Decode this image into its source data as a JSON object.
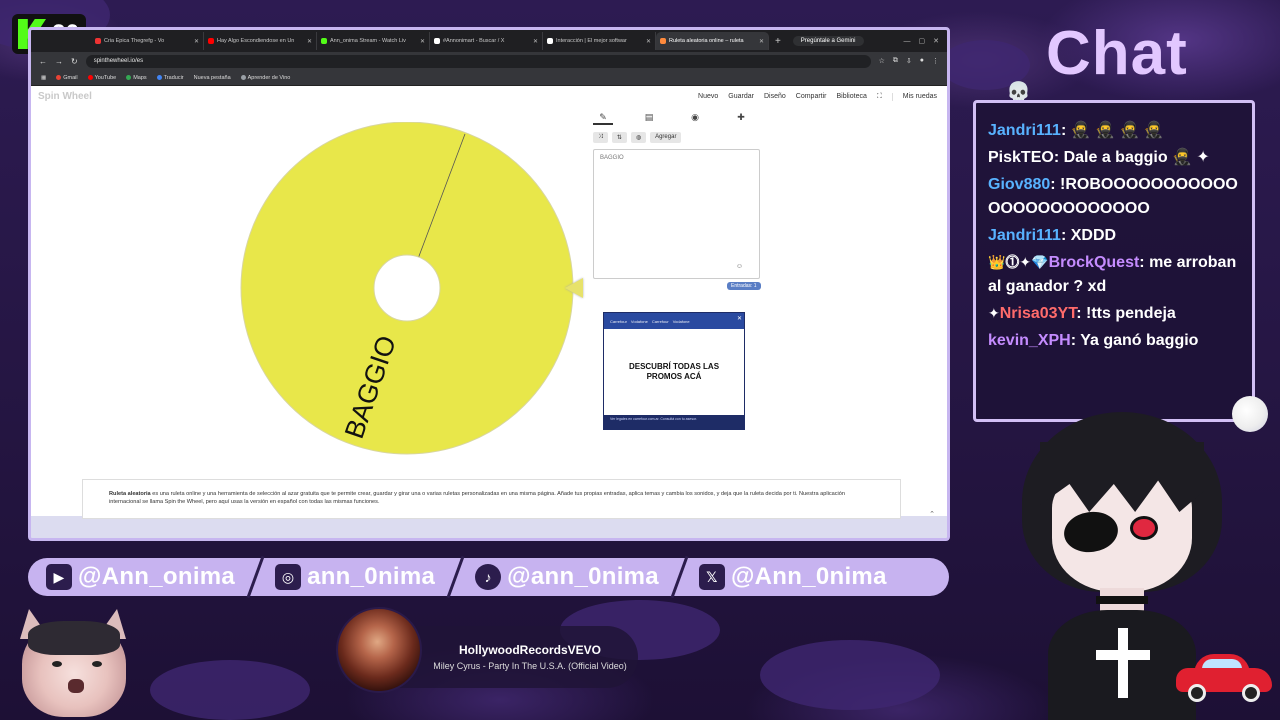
{
  "stream": {
    "viewer_count": "26"
  },
  "browser": {
    "tabs": [
      {
        "label": "Cria Épica Thegrefg - Vo",
        "color": "#e33"
      },
      {
        "label": "Hay Algo Escondiendose en Un",
        "color": "#f00"
      },
      {
        "label": "Ann_onima Stream - Watch Liv",
        "color": "#53fc18"
      },
      {
        "label": "#Annonimart - Buscar / X",
        "color": "#ffffff"
      },
      {
        "label": "Interacción | El mejor softwar",
        "color": "#ffffff"
      },
      {
        "label": "Ruleta aleatoria online – ruleta",
        "color": "#ff8a3d"
      }
    ],
    "gemini_label": "Pregúntale a Gemini",
    "url": "spinthewheel.io/es",
    "bookmarks": [
      {
        "label": "Gmail",
        "color": "#ea4335"
      },
      {
        "label": "YouTube",
        "color": "#ff0000"
      },
      {
        "label": "Maps",
        "color": "#34a853"
      },
      {
        "label": "Traducir",
        "color": "#4285f4"
      },
      {
        "label": "Nueva pestaña",
        "color": "#9aa0a6"
      },
      {
        "label": "Aprender de Vino",
        "color": "#9aa0a6"
      }
    ]
  },
  "site": {
    "logo": "Spin Wheel",
    "menu": [
      "Nuevo",
      "Guardar",
      "Diseño",
      "Compartir",
      "Biblioteca",
      "Mis ruedas"
    ],
    "tools": [
      "Agregar"
    ],
    "wheel": {
      "segment_label": "BAGGIO",
      "color": "#e8e74a"
    },
    "entries_text": "BAGGIO",
    "entries_count": "Entradas: 1",
    "ad": {
      "brands": [
        "Carrefour",
        "Vodafone",
        "Carrefour",
        "Vodafone"
      ],
      "headline": "DESCUBRÍ TODAS LAS PROMOS ACÁ",
      "footer": "Ver legales en carrefour.com.ar. Consultá con tu asesor."
    },
    "description_bold": "Ruleta aleatoria",
    "description": " es una ruleta online y una herramienta de selección al azar gratuita que te permite crear, guardar y girar una o varias ruletas personalizadas en una misma página. Añade tus propias entradas, aplica temas y cambia los sonidos, y deja que la ruleta decida por ti. Nuestra aplicación internacional se llama Spin the Wheel, pero aquí usas la versión en español con todas las mismas funciones."
  },
  "socials": [
    {
      "icon": "youtube-icon",
      "glyph": "▶",
      "handle": "@Ann_onima"
    },
    {
      "icon": "instagram-icon",
      "glyph": "◎",
      "handle": "ann_0nima"
    },
    {
      "icon": "tiktok-icon",
      "glyph": "♪",
      "handle": "@ann_0nima"
    },
    {
      "icon": "x-icon",
      "glyph": "𝕏",
      "handle": "@Ann_0nima"
    }
  ],
  "now_playing": {
    "channel": "HollywoodRecordsVEVO",
    "title": "Miley Cyrus - Party In The U.S.A. (Official Video)"
  },
  "chat": {
    "title": "Chat",
    "messages": [
      {
        "badges": "",
        "user": "Jandri111",
        "user_color": "u-blue",
        "text": "🥷 🥷 🥷 🥷"
      },
      {
        "badges": "",
        "user": "PiskTEO",
        "user_color": "",
        "text": "Dale a baggio 🥷 ✦"
      },
      {
        "badges": "",
        "user": "Giov880",
        "user_color": "u-blue",
        "text": "!ROBOOOOOOOOOOOOOOOOOOOOOOOO"
      },
      {
        "badges": "",
        "user": "Jandri111",
        "user_color": "u-blue",
        "text": "XDDD"
      },
      {
        "badges": "👑⓵✦💎",
        "user": "BrockQuest",
        "user_color": "u-purple",
        "text": "me arroban al ganador ? xd"
      },
      {
        "badges": "✦",
        "user": "Nrisa03YT",
        "user_color": "u-red",
        "text": "!tts pendeja"
      },
      {
        "badges": "",
        "user": "kevin_XPH",
        "user_color": "u-purple",
        "text": "Ya ganó baggio"
      }
    ]
  }
}
